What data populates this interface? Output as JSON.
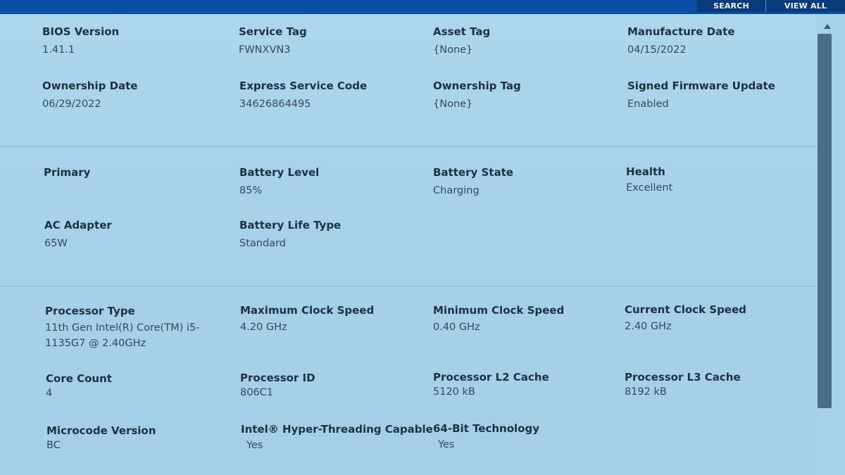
{
  "toolbar": {
    "search_label": "SEARCH",
    "view_all_label": "VIEW ALL"
  },
  "colors": {
    "topbar": "#0b4ea6",
    "panel_bg": "#a9d3ea",
    "scroll_thumb": "#496f87"
  },
  "system": {
    "bios_version": {
      "label": "BIOS Version",
      "value": "1.41.1"
    },
    "service_tag": {
      "label": "Service Tag",
      "value": "FWNXVN3"
    },
    "asset_tag": {
      "label": "Asset Tag",
      "value": "{None}"
    },
    "manufacture_date": {
      "label": "Manufacture Date",
      "value": "04/15/2022"
    },
    "ownership_date": {
      "label": "Ownership Date",
      "value": "06/29/2022"
    },
    "express_service_code": {
      "label": "Express Service Code",
      "value": "34626864495"
    },
    "ownership_tag": {
      "label": "Ownership Tag",
      "value": "{None}"
    },
    "signed_firmware_update": {
      "label": "Signed Firmware Update",
      "value": "Enabled"
    }
  },
  "battery": {
    "primary": {
      "label": "Primary",
      "value": ""
    },
    "battery_level": {
      "label": "Battery Level",
      "value": "85%"
    },
    "battery_state": {
      "label": "Battery State",
      "value": "Charging"
    },
    "health": {
      "label": "Health",
      "value": "Excellent"
    },
    "ac_adapter": {
      "label": "AC Adapter",
      "value": "65W"
    },
    "battery_life_type": {
      "label": "Battery Life Type",
      "value": "Standard"
    }
  },
  "processor": {
    "processor_type": {
      "label": "Processor Type",
      "value": "11th Gen Intel(R) Core(TM) i5-1135G7 @ 2.40GHz"
    },
    "max_clock_speed": {
      "label": "Maximum Clock Speed",
      "value": "4.20 GHz"
    },
    "min_clock_speed": {
      "label": "Minimum Clock Speed",
      "value": "0.40 GHz"
    },
    "current_clock_speed": {
      "label": "Current Clock Speed",
      "value": "2.40 GHz"
    },
    "core_count": {
      "label": "Core Count",
      "value": "4"
    },
    "processor_id": {
      "label": "Processor ID",
      "value": "806C1"
    },
    "l2_cache": {
      "label": "Processor L2 Cache",
      "value": "5120 kB"
    },
    "l3_cache": {
      "label": "Processor L3 Cache",
      "value": "8192 kB"
    },
    "microcode_version": {
      "label": "Microcode Version",
      "value": "BC"
    },
    "hyper_threading": {
      "label": "Intel® Hyper-Threading Capable",
      "value": "Yes"
    },
    "bit64_technology": {
      "label": "64-Bit Technology",
      "value": "Yes"
    }
  }
}
